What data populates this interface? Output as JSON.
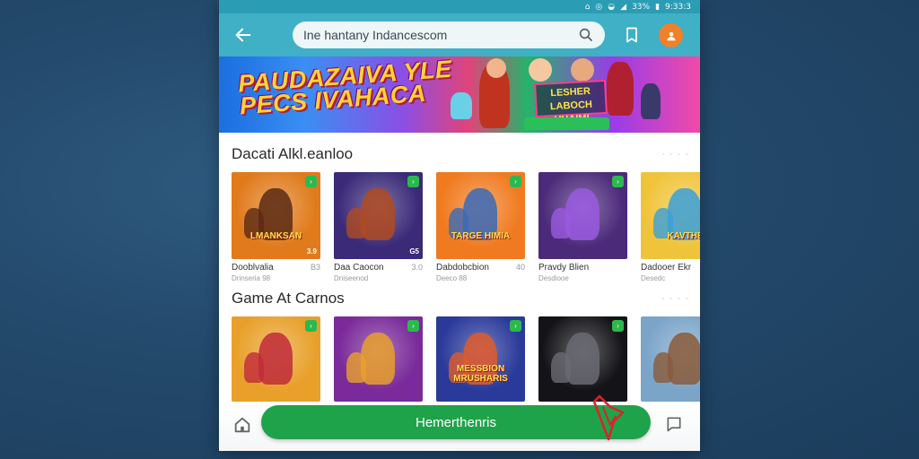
{
  "status_bar": {
    "battery": "33%",
    "time": "9:33:3"
  },
  "app_bar": {
    "search_value": "Ine hantany Indancescom",
    "icons": [
      "back-arrow-icon",
      "search-icon",
      "bookmark-icon",
      "avatar"
    ]
  },
  "banner": {
    "title": "PAUDAZAIVA YLE\nPECS IVAHACA",
    "tag": "",
    "right_label": "LESHER\nLABOCH UHAIMI",
    "pill": ""
  },
  "sections": [
    {
      "title": "Dacati Alkl.eanloo",
      "more": "· · · ·",
      "cards": [
        {
          "art_text": "LMANKSAN",
          "name": "Dooblvalia",
          "meta": "B3",
          "sub": "Drinseria 98",
          "score": "3.9",
          "bg": "#e07a1a",
          "fig": "#5b2a14"
        },
        {
          "art_text": "",
          "name": "Daa Caocon",
          "meta": "3.0",
          "sub": "Dniseenod",
          "score": "G5",
          "bg": "#3a2a78",
          "fig": "#b04a20"
        },
        {
          "art_text": "TARGE HIMIA",
          "name": "Dabdobcbion",
          "meta": "40",
          "sub": "Deeco 88",
          "score": "",
          "bg": "#f07a1f",
          "fig": "#3a6ab8"
        },
        {
          "art_text": "",
          "name": "Pravdy Blien",
          "meta": "",
          "sub": "Desdiooe",
          "score": "",
          "bg": "#4b2a7a",
          "fig": "#9a5ae0"
        },
        {
          "art_text": "KAVTHE",
          "name": "Dadooer Ekr",
          "meta": "",
          "sub": "Desedc",
          "score": "",
          "bg": "#f0c43a",
          "fig": "#3aa0d8"
        }
      ]
    },
    {
      "title": "Game At Carnos",
      "more": "· · · ·",
      "cards": [
        {
          "art_text": "",
          "name": "",
          "meta": "",
          "sub": "",
          "score": "",
          "bg": "#e8a02a",
          "fig": "#c02a3a"
        },
        {
          "art_text": "",
          "name": "",
          "meta": "",
          "sub": "",
          "score": "",
          "bg": "#7a2a9a",
          "fig": "#e8a02a"
        },
        {
          "art_text": "MESSBION\nMRUSHARIS",
          "name": "",
          "meta": "",
          "sub": "",
          "score": "",
          "bg": "#2a3a9a",
          "fig": "#e05a2a"
        },
        {
          "art_text": "",
          "name": "",
          "meta": "",
          "sub": "",
          "score": "",
          "bg": "#141418",
          "fig": "#6a6a72"
        },
        {
          "art_text": "",
          "name": "",
          "meta": "",
          "sub": "",
          "score": "",
          "bg": "#7aa4c8",
          "fig": "#8a5a3a"
        }
      ]
    }
  ],
  "bottom": {
    "cta_label": "Hemerthenris"
  },
  "colors": {
    "header": "#3fb0c6",
    "cta": "#1fa34a",
    "badge": "#2db84f",
    "avatar": "#f0812a"
  }
}
